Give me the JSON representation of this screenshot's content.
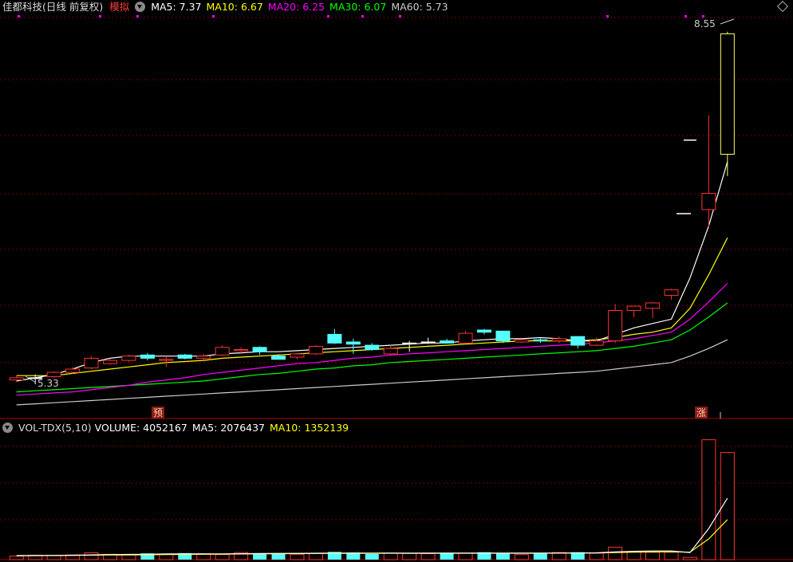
{
  "header": {
    "stock_name": "佳都科技(日线 前复权)",
    "mode_badge": "模拟",
    "ma_labels": [
      {
        "text": "MA5: 7.37",
        "color": "#ffffff"
      },
      {
        "text": "MA10: 6.67",
        "color": "#ffff00"
      },
      {
        "text": "MA20: 6.25",
        "color": "#ff00ff"
      },
      {
        "text": "MA30: 6.07",
        "color": "#00ff00"
      },
      {
        "text": "MA60: 5.73",
        "color": "#cccccc"
      }
    ]
  },
  "volume_header": {
    "indicator": "VOL-TDX(5,10)",
    "labels": [
      {
        "text": "VOLUME: 4052167",
        "color": "#ffffff"
      },
      {
        "text": "MA5: 2076437",
        "color": "#ffffff"
      },
      {
        "text": "MA10: 1352139",
        "color": "#ffff00"
      }
    ]
  },
  "annotations": {
    "high_label": "8.55",
    "low_label": "5.33",
    "marker_pre": "预",
    "marker_limit": "涨"
  },
  "colors": {
    "up": "#ff3232",
    "down": "#54ffff",
    "grid": "#7a0000",
    "ma5": "#ffffff",
    "ma10": "#ffff00",
    "ma20": "#ff00ff",
    "ma30": "#00ff00",
    "ma60": "#cccccc"
  },
  "chart_data": {
    "type": "candlestick",
    "price_range": [
      5.1,
      8.7
    ],
    "candles": [
      {
        "o": 5.36,
        "h": 5.4,
        "l": 5.34,
        "c": 5.38
      },
      {
        "o": 5.38,
        "h": 5.41,
        "l": 5.32,
        "c": 5.38
      },
      {
        "o": 5.39,
        "h": 5.44,
        "l": 5.38,
        "c": 5.43
      },
      {
        "o": 5.43,
        "h": 5.48,
        "l": 5.42,
        "c": 5.46
      },
      {
        "o": 5.47,
        "h": 5.58,
        "l": 5.46,
        "c": 5.56
      },
      {
        "o": 5.51,
        "h": 5.56,
        "l": 5.5,
        "c": 5.54
      },
      {
        "o": 5.54,
        "h": 5.59,
        "l": 5.53,
        "c": 5.58
      },
      {
        "o": 5.59,
        "h": 5.61,
        "l": 5.54,
        "c": 5.56
      },
      {
        "o": 5.54,
        "h": 5.58,
        "l": 5.48,
        "c": 5.55
      },
      {
        "o": 5.59,
        "h": 5.6,
        "l": 5.55,
        "c": 5.56
      },
      {
        "o": 5.56,
        "h": 5.6,
        "l": 5.54,
        "c": 5.58
      },
      {
        "o": 5.59,
        "h": 5.68,
        "l": 5.58,
        "c": 5.66
      },
      {
        "o": 5.63,
        "h": 5.66,
        "l": 5.6,
        "c": 5.64
      },
      {
        "o": 5.66,
        "h": 5.67,
        "l": 5.59,
        "c": 5.62
      },
      {
        "o": 5.58,
        "h": 5.6,
        "l": 5.55,
        "c": 5.55
      },
      {
        "o": 5.57,
        "h": 5.6,
        "l": 5.55,
        "c": 5.6
      },
      {
        "o": 5.6,
        "h": 5.68,
        "l": 5.59,
        "c": 5.67
      },
      {
        "o": 5.78,
        "h": 5.83,
        "l": 5.69,
        "c": 5.7
      },
      {
        "o": 5.71,
        "h": 5.74,
        "l": 5.6,
        "c": 5.69
      },
      {
        "o": 5.68,
        "h": 5.7,
        "l": 5.63,
        "c": 5.64
      },
      {
        "o": 5.6,
        "h": 5.68,
        "l": 5.59,
        "c": 5.65
      },
      {
        "o": 5.7,
        "h": 5.72,
        "l": 5.62,
        "c": 5.7
      },
      {
        "o": 5.71,
        "h": 5.75,
        "l": 5.69,
        "c": 5.71
      },
      {
        "o": 5.72,
        "h": 5.74,
        "l": 5.7,
        "c": 5.7
      },
      {
        "o": 5.7,
        "h": 5.81,
        "l": 5.69,
        "c": 5.79
      },
      {
        "o": 5.82,
        "h": 5.83,
        "l": 5.78,
        "c": 5.8
      },
      {
        "o": 5.81,
        "h": 5.81,
        "l": 5.7,
        "c": 5.72
      },
      {
        "o": 5.71,
        "h": 5.73,
        "l": 5.7,
        "c": 5.73
      },
      {
        "o": 5.73,
        "h": 5.75,
        "l": 5.7,
        "c": 5.72
      },
      {
        "o": 5.72,
        "h": 5.76,
        "l": 5.7,
        "c": 5.74
      },
      {
        "o": 5.76,
        "h": 5.76,
        "l": 5.65,
        "c": 5.68
      },
      {
        "o": 5.68,
        "h": 5.75,
        "l": 5.67,
        "c": 5.72
      },
      {
        "o": 5.72,
        "h": 6.06,
        "l": 5.7,
        "c": 6.0
      },
      {
        "o": 6.0,
        "h": 6.04,
        "l": 5.94,
        "c": 6.04
      },
      {
        "o": 6.02,
        "h": 6.08,
        "l": 5.93,
        "c": 6.07
      },
      {
        "o": 6.14,
        "h": 6.2,
        "l": 6.1,
        "c": 6.19
      },
      {
        "o": 7.57,
        "h": 7.57,
        "l": 7.57,
        "c": 7.57
      },
      {
        "o": 6.93,
        "h": 7.8,
        "l": 6.76,
        "c": 7.08
      },
      {
        "o": 7.44,
        "h": 8.57,
        "l": 7.24,
        "c": 8.55
      }
    ],
    "ma5": [
      5.35,
      5.38,
      5.41,
      5.46,
      5.52,
      5.56,
      5.58,
      5.58,
      5.58,
      5.58,
      5.58,
      5.6,
      5.61,
      5.62,
      5.62,
      5.63,
      5.64,
      5.65,
      5.66,
      5.67,
      5.68,
      5.69,
      5.7,
      5.7,
      5.72,
      5.73,
      5.74,
      5.74,
      5.75,
      5.74,
      5.72,
      5.72,
      5.78,
      5.84,
      5.88,
      5.92,
      6.3,
      6.78,
      7.37
    ],
    "ma10": [
      5.4,
      5.4,
      5.4,
      5.42,
      5.44,
      5.46,
      5.48,
      5.5,
      5.52,
      5.53,
      5.54,
      5.56,
      5.57,
      5.58,
      5.59,
      5.6,
      5.61,
      5.62,
      5.63,
      5.64,
      5.65,
      5.66,
      5.67,
      5.68,
      5.69,
      5.7,
      5.71,
      5.72,
      5.72,
      5.72,
      5.72,
      5.73,
      5.75,
      5.78,
      5.8,
      5.84,
      6.02,
      6.33,
      6.67
    ],
    "ma20": [
      5.22,
      5.23,
      5.24,
      5.25,
      5.27,
      5.29,
      5.31,
      5.34,
      5.36,
      5.38,
      5.41,
      5.43,
      5.45,
      5.47,
      5.49,
      5.51,
      5.52,
      5.54,
      5.56,
      5.57,
      5.59,
      5.6,
      5.61,
      5.62,
      5.63,
      5.64,
      5.65,
      5.66,
      5.67,
      5.68,
      5.69,
      5.7,
      5.72,
      5.74,
      5.77,
      5.8,
      5.92,
      6.08,
      6.25
    ],
    "ma30": [
      5.25,
      5.26,
      5.27,
      5.28,
      5.29,
      5.3,
      5.31,
      5.32,
      5.33,
      5.34,
      5.35,
      5.37,
      5.39,
      5.41,
      5.42,
      5.44,
      5.46,
      5.47,
      5.49,
      5.5,
      5.52,
      5.53,
      5.54,
      5.55,
      5.56,
      5.57,
      5.58,
      5.59,
      5.6,
      5.61,
      5.62,
      5.63,
      5.65,
      5.67,
      5.7,
      5.73,
      5.82,
      5.94,
      6.07
    ],
    "ma60": [
      5.13,
      5.14,
      5.15,
      5.16,
      5.17,
      5.18,
      5.19,
      5.2,
      5.21,
      5.22,
      5.23,
      5.24,
      5.25,
      5.26,
      5.27,
      5.28,
      5.29,
      5.3,
      5.31,
      5.32,
      5.33,
      5.34,
      5.35,
      5.36,
      5.37,
      5.38,
      5.39,
      5.4,
      5.41,
      5.42,
      5.43,
      5.44,
      5.46,
      5.48,
      5.5,
      5.52,
      5.58,
      5.65,
      5.73
    ],
    "volume_range": [
      0,
      4150000
    ],
    "volume": [
      120000,
      150000,
      140000,
      160000,
      230000,
      180000,
      170000,
      210000,
      180000,
      220000,
      200000,
      170000,
      240000,
      210000,
      200000,
      180000,
      210000,
      260000,
      240000,
      190000,
      220000,
      210000,
      200000,
      230000,
      220000,
      250000,
      200000,
      170000,
      200000,
      240000,
      250000,
      220000,
      420000,
      270000,
      250000,
      250000,
      75000,
      4052167,
      3620000
    ],
    "volume_ma5": [
      130000,
      135000,
      140000,
      145000,
      160000,
      170000,
      175000,
      180000,
      190000,
      195000,
      195000,
      195000,
      200000,
      205000,
      210000,
      210000,
      215000,
      220000,
      220000,
      220000,
      220000,
      215000,
      215000,
      215000,
      215000,
      215000,
      215000,
      215000,
      215000,
      220000,
      225000,
      230000,
      260000,
      280000,
      290000,
      290000,
      240000,
      1050000,
      2076437
    ],
    "volume_ma10": [
      140000,
      140000,
      142000,
      145000,
      150000,
      155000,
      160000,
      165000,
      170000,
      175000,
      180000,
      185000,
      190000,
      195000,
      200000,
      205000,
      208000,
      210000,
      212000,
      214000,
      215000,
      216000,
      217000,
      218000,
      218000,
      219000,
      220000,
      220000,
      221000,
      222000,
      223000,
      225000,
      240000,
      250000,
      260000,
      265000,
      250000,
      700000,
      1352139
    ]
  }
}
